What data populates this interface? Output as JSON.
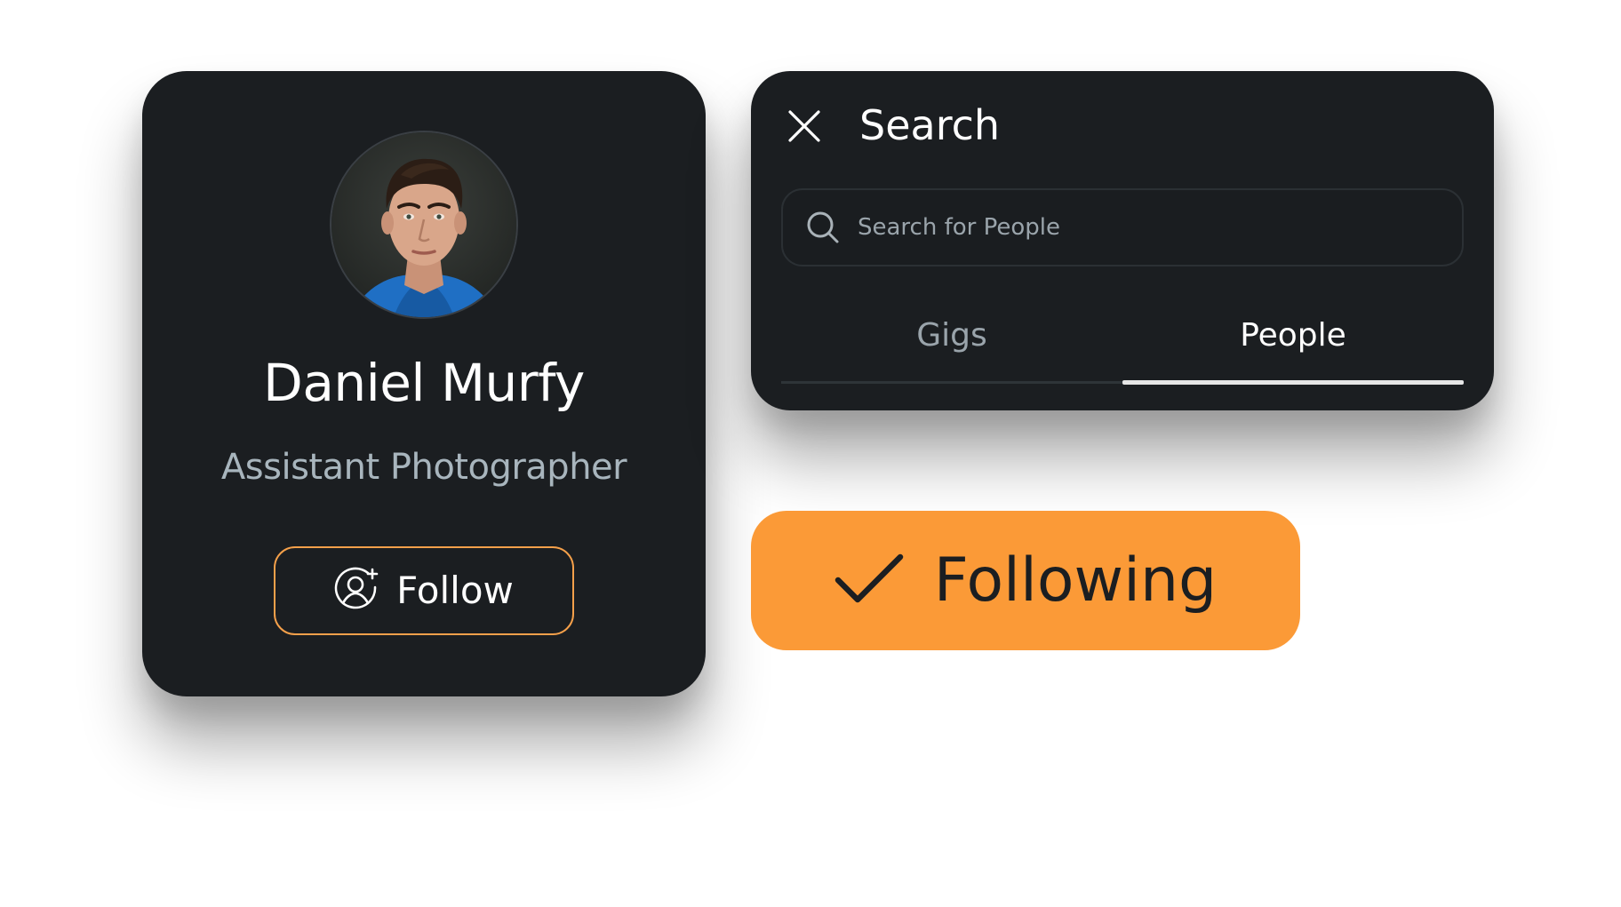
{
  "profile_card": {
    "avatar_alt": "Daniel Murfy avatar",
    "name": "Daniel Murfy",
    "role": "Assistant Photographer",
    "follow_button": {
      "label": "Follow",
      "icon": "add-user-icon"
    }
  },
  "search_panel": {
    "close_icon": "close-icon",
    "title": "Search",
    "search_input": {
      "icon": "search-icon",
      "placeholder": "Search for People",
      "value": ""
    },
    "tabs": [
      {
        "label": "Gigs",
        "active": false
      },
      {
        "label": "People",
        "active": true
      }
    ]
  },
  "following_button": {
    "label": "Following",
    "icon": "check-icon"
  },
  "colors": {
    "card_background": "#1b1e21",
    "accent_orange": "#fb9a37",
    "follow_border": "#f5a04a",
    "muted_text": "#9aa4ab",
    "role_text": "#a8b5bd",
    "text_primary": "#ffffff"
  }
}
